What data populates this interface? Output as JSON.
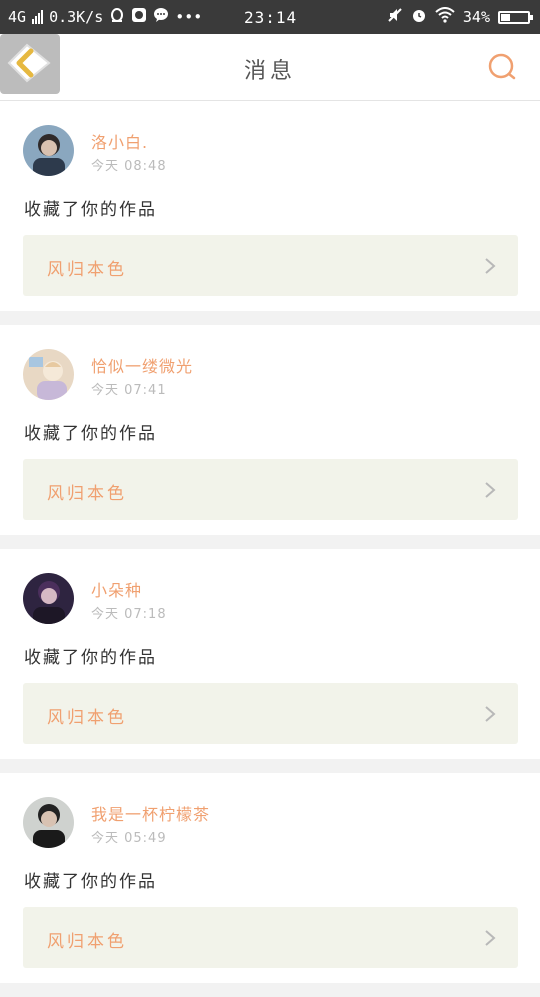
{
  "status_bar": {
    "network": "4G",
    "speed": "0.3K/s",
    "time": "23:14",
    "battery": "34%",
    "battery_level": 0.34,
    "icons": [
      "signal-icon",
      "qq-icon",
      "photo-icon",
      "chat-icon",
      "more-dots-icon",
      "mute-icon",
      "alarm-icon",
      "wifi-icon",
      "battery-icon"
    ]
  },
  "header": {
    "title": "消息",
    "back_icon": "back-arrow-icon",
    "search_icon": "search-icon",
    "accent": "#f0a070"
  },
  "messages": [
    {
      "user": "洛小白.",
      "time": "今天  08:48",
      "action": "收藏了你的作品",
      "work": "风归本色"
    },
    {
      "user": "恰似一缕微光",
      "time": "今天  07:41",
      "action": "收藏了你的作品",
      "work": "风归本色"
    },
    {
      "user": "小朵种",
      "time": "今天  07:18",
      "action": "收藏了你的作品",
      "work": "风归本色"
    },
    {
      "user": "我是一杯柠檬茶",
      "time": "今天  05:49",
      "action": "收藏了你的作品",
      "work": "风归本色"
    }
  ]
}
